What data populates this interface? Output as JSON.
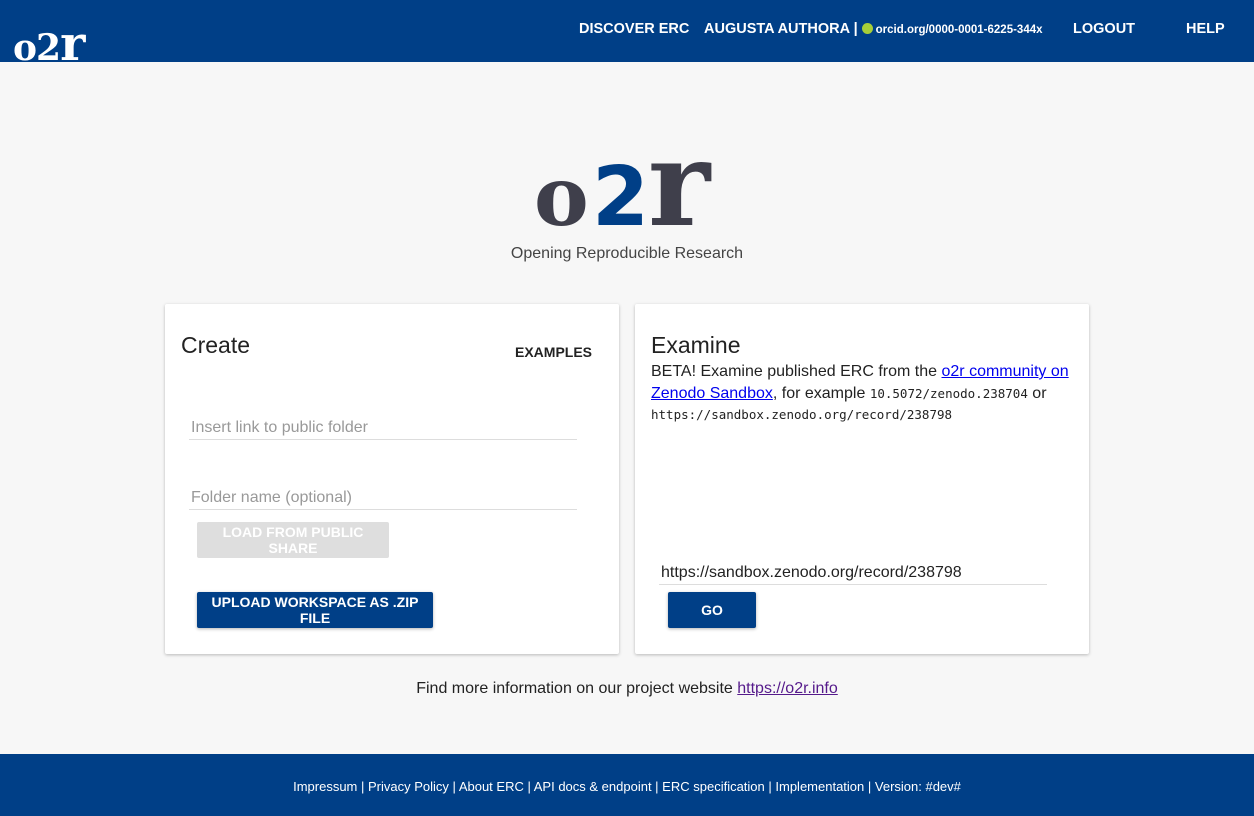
{
  "header": {
    "logo_o2": "o2",
    "logo_r": "r",
    "nav": {
      "discover": "DISCOVER ERC",
      "user": "AUGUSTA AUTHORA",
      "separator": "|",
      "orcid": "orcid.org/0000-0001-6225-344x",
      "logout": "LOGOUT",
      "help": "HELP"
    }
  },
  "hero": {
    "logo_o": "o",
    "logo_2": "2",
    "logo_r": "r",
    "tagline": "Opening Reproducible Research"
  },
  "create": {
    "title": "Create",
    "examples_label": "EXAMPLES",
    "link_placeholder": "Insert link to public folder",
    "folder_placeholder": "Folder name (optional)",
    "load_label": "LOAD FROM PUBLIC SHARE",
    "upload_label": "UPLOAD WORKSPACE AS .ZIP FILE"
  },
  "examine": {
    "title": "Examine",
    "text_before": "BETA! Examine published ERC from the ",
    "link_text": "o2r community on Zenodo Sandbox",
    "text_mid": ", for example ",
    "example_doi": "10.5072/zenodo.238704",
    "text_or": " or ",
    "example_url": "https://sandbox.zenodo.org/record/238798",
    "input_value": "https://sandbox.zenodo.org/record/238798",
    "go_label": "GO"
  },
  "info": {
    "text": "Find more information on our project website ",
    "link": "https://o2r.info"
  },
  "footer": {
    "impressum": "Impressum",
    "privacy": "Privacy Policy",
    "about": "About ERC",
    "api": "API docs & endpoint",
    "spec": "ERC specification",
    "implementation": "Implementation",
    "version": "Version: #dev#",
    "sep": " | "
  },
  "colors": {
    "brand_blue": "#003f87",
    "logo_gray": "#3f3f4b",
    "orcid_green": "#a6ce39"
  }
}
